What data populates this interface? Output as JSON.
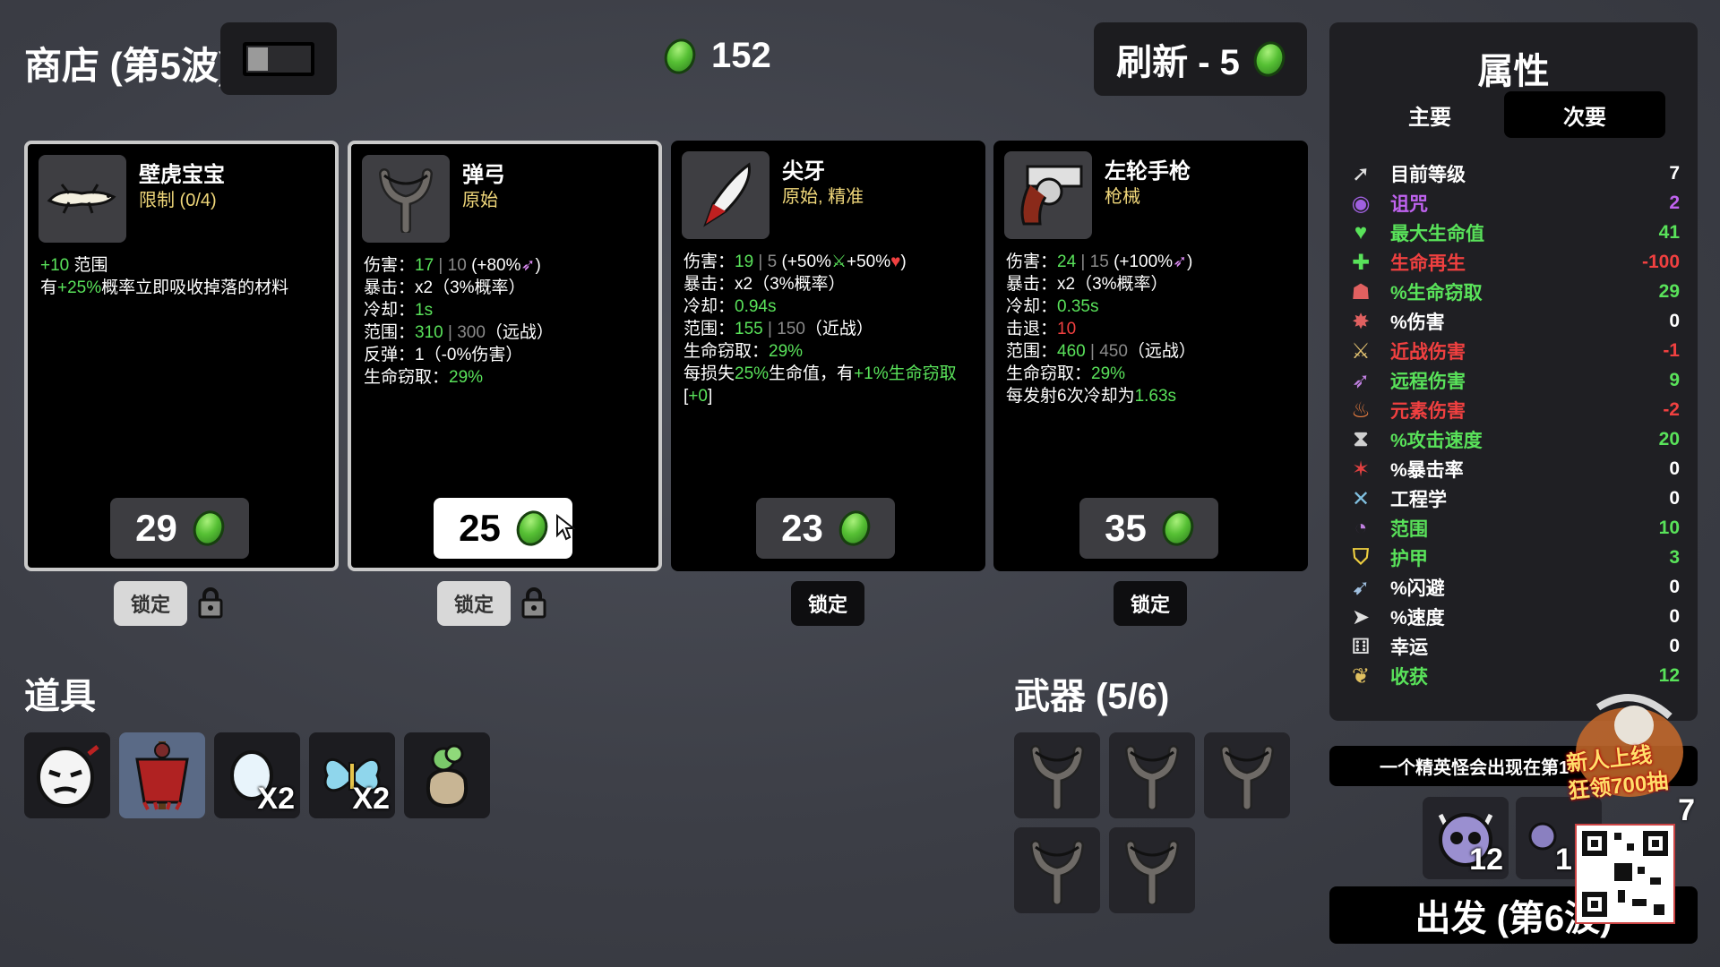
{
  "header": {
    "shop_title": "商店 (第5波)",
    "gold": "152",
    "refresh_label": "刷新 - 5"
  },
  "cards": [
    {
      "name": "壁虎宝宝",
      "tag": "限制 (0/4)",
      "icon": "gecko-icon",
      "lines": [
        [
          {
            "t": "+10",
            "c": "g"
          },
          {
            "t": " 范围",
            "c": ""
          }
        ],
        [
          {
            "t": "有",
            "c": ""
          },
          {
            "t": "+25%",
            "c": "g"
          },
          {
            "t": "概率立即吸收掉落的材料",
            "c": ""
          }
        ]
      ],
      "price": "29",
      "lock_label": "锁定",
      "locked": true
    },
    {
      "name": "弹弓",
      "tag": "原始",
      "icon": "slingshot-icon",
      "lines": [
        [
          {
            "t": "伤害：",
            "c": ""
          },
          {
            "t": "17",
            "c": "g"
          },
          {
            "t": " | 10 ",
            "c": "dim"
          },
          {
            "t": "(+80%",
            "c": ""
          },
          {
            "t": "➶",
            "c": "pk"
          },
          {
            "t": ")",
            "c": ""
          }
        ],
        [
          {
            "t": "暴击：x2（3%概率）",
            "c": ""
          }
        ],
        [
          {
            "t": "冷却：",
            "c": ""
          },
          {
            "t": "1s",
            "c": "g"
          }
        ],
        [
          {
            "t": "范围：",
            "c": ""
          },
          {
            "t": "310",
            "c": "g"
          },
          {
            "t": " | 300",
            "c": "dim"
          },
          {
            "t": "（远战）",
            "c": ""
          }
        ],
        [
          {
            "t": "反弹：1（-0%伤害）",
            "c": ""
          }
        ],
        [
          {
            "t": "生命窃取：",
            "c": ""
          },
          {
            "t": "29%",
            "c": "g"
          }
        ]
      ],
      "price": "25",
      "lock_label": "锁定",
      "locked": true
    },
    {
      "name": "尖牙",
      "tag": "原始, 精准",
      "icon": "fang-icon",
      "lines": [
        [
          {
            "t": "伤害：",
            "c": ""
          },
          {
            "t": "19",
            "c": "g"
          },
          {
            "t": " | 5 ",
            "c": "dim"
          },
          {
            "t": "(+50%",
            "c": ""
          },
          {
            "t": "⚔",
            "c": "g"
          },
          {
            "t": "+50%",
            "c": ""
          },
          {
            "t": "♥",
            "c": "r"
          },
          {
            "t": ")",
            "c": ""
          }
        ],
        [
          {
            "t": "暴击：x2（3%概率）",
            "c": ""
          }
        ],
        [
          {
            "t": "冷却：",
            "c": ""
          },
          {
            "t": "0.94s",
            "c": "g"
          }
        ],
        [
          {
            "t": "范围：",
            "c": ""
          },
          {
            "t": "155",
            "c": "g"
          },
          {
            "t": " | 150",
            "c": "dim"
          },
          {
            "t": "（近战）",
            "c": ""
          }
        ],
        [
          {
            "t": "生命窃取：",
            "c": ""
          },
          {
            "t": "29%",
            "c": "g"
          }
        ],
        [
          {
            "t": "每损失",
            "c": ""
          },
          {
            "t": "25%",
            "c": "g"
          },
          {
            "t": "生命值，有",
            "c": ""
          },
          {
            "t": "+1%生命窃取",
            "c": "g"
          }
        ],
        [
          {
            "t": "[",
            "c": ""
          },
          {
            "t": "+0",
            "c": "g"
          },
          {
            "t": "]",
            "c": ""
          }
        ]
      ],
      "price": "23",
      "lock_label": "锁定",
      "locked": false
    },
    {
      "name": "左轮手枪",
      "tag": "枪械",
      "icon": "revolver-icon",
      "lines": [
        [
          {
            "t": "伤害：",
            "c": ""
          },
          {
            "t": "24",
            "c": "g"
          },
          {
            "t": " | 15 ",
            "c": "dim"
          },
          {
            "t": "(+100%",
            "c": ""
          },
          {
            "t": "➶",
            "c": "pk"
          },
          {
            "t": ")",
            "c": ""
          }
        ],
        [
          {
            "t": "暴击：x2（3%概率）",
            "c": ""
          }
        ],
        [
          {
            "t": "冷却：",
            "c": ""
          },
          {
            "t": "0.35s",
            "c": "g"
          }
        ],
        [
          {
            "t": "击退：",
            "c": ""
          },
          {
            "t": "10",
            "c": "r"
          }
        ],
        [
          {
            "t": "范围：",
            "c": ""
          },
          {
            "t": "460",
            "c": "g"
          },
          {
            "t": " | 450",
            "c": "dim"
          },
          {
            "t": "（远战）",
            "c": ""
          }
        ],
        [
          {
            "t": "生命窃取：",
            "c": ""
          },
          {
            "t": "29%",
            "c": "g"
          }
        ],
        [
          {
            "t": "每发射6次冷却为",
            "c": ""
          },
          {
            "t": "1.63s",
            "c": "g"
          }
        ]
      ],
      "price": "35",
      "lock_label": "锁定",
      "locked": false
    }
  ],
  "items_section": {
    "title": "道具",
    "items": [
      {
        "icon": "mask-icon",
        "count": ""
      },
      {
        "icon": "scarecrow-icon",
        "count": ""
      },
      {
        "icon": "egg-icon",
        "count": "X2"
      },
      {
        "icon": "butterfly-icon",
        "count": "X2"
      },
      {
        "icon": "sack-icon",
        "count": ""
      }
    ]
  },
  "weapons_section": {
    "title": "武器 (5/6)",
    "weapons": [
      "slingshot-icon",
      "slingshot-icon",
      "slingshot-icon",
      "slingshot-icon",
      "slingshot-icon"
    ]
  },
  "stats_panel": {
    "title": "属性",
    "tab_primary": "主要",
    "tab_secondary": "次要",
    "rows": [
      {
        "icon": "level-icon",
        "label": "目前等级",
        "value": "7",
        "color": "#ffffff",
        "vcolor": "#ffffff"
      },
      {
        "icon": "curse-icon",
        "label": "诅咒",
        "value": "2",
        "color": "#c063f0",
        "vcolor": "#c063f0"
      },
      {
        "icon": "heart-icon",
        "label": "最大生命值",
        "value": "41",
        "color": "#59e25a",
        "vcolor": "#59e25a"
      },
      {
        "icon": "regen-icon",
        "label": "生命再生",
        "value": "-100",
        "color": "#f04040",
        "vcolor": "#f04040"
      },
      {
        "icon": "lifesteal-icon",
        "label": "%生命窃取",
        "value": "29",
        "color": "#59e25a",
        "vcolor": "#59e25a"
      },
      {
        "icon": "damage-icon",
        "label": "%伤害",
        "value": "0",
        "color": "#ffffff",
        "vcolor": "#ffffff"
      },
      {
        "icon": "melee-icon",
        "label": "近战伤害",
        "value": "-1",
        "color": "#f04040",
        "vcolor": "#f04040"
      },
      {
        "icon": "ranged-icon",
        "label": "远程伤害",
        "value": "9",
        "color": "#59e25a",
        "vcolor": "#59e25a"
      },
      {
        "icon": "elemental-icon",
        "label": "元素伤害",
        "value": "-2",
        "color": "#f04040",
        "vcolor": "#f04040"
      },
      {
        "icon": "attack-speed-icon",
        "label": "%攻击速度",
        "value": "20",
        "color": "#59e25a",
        "vcolor": "#59e25a"
      },
      {
        "icon": "crit-icon",
        "label": "%暴击率",
        "value": "0",
        "color": "#ffffff",
        "vcolor": "#ffffff"
      },
      {
        "icon": "engineering-icon",
        "label": "工程学",
        "value": "0",
        "color": "#ffffff",
        "vcolor": "#ffffff"
      },
      {
        "icon": "range-icon",
        "label": "范围",
        "value": "10",
        "color": "#59e25a",
        "vcolor": "#59e25a"
      },
      {
        "icon": "armor-icon",
        "label": "护甲",
        "value": "3",
        "color": "#59e25a",
        "vcolor": "#59e25a"
      },
      {
        "icon": "dodge-icon",
        "label": "%闪避",
        "value": "0",
        "color": "#ffffff",
        "vcolor": "#ffffff"
      },
      {
        "icon": "speed-icon",
        "label": "%速度",
        "value": "0",
        "color": "#ffffff",
        "vcolor": "#ffffff"
      },
      {
        "icon": "luck-icon",
        "label": "幸运",
        "value": "0",
        "color": "#ffffff",
        "vcolor": "#ffffff"
      },
      {
        "icon": "harvest-icon",
        "label": "收获",
        "value": "12",
        "color": "#59e25a",
        "vcolor": "#59e25a"
      }
    ]
  },
  "wave_info": {
    "elite_text": "一个精英怪会出现在第1",
    "enemy_count_1": "12",
    "enemy_count_2": "1",
    "enemy_count_3": "7",
    "go_label": "出发 (第6波)"
  },
  "promo": {
    "text_line1": "新人上线",
    "text_line2": "狂领700抽"
  }
}
